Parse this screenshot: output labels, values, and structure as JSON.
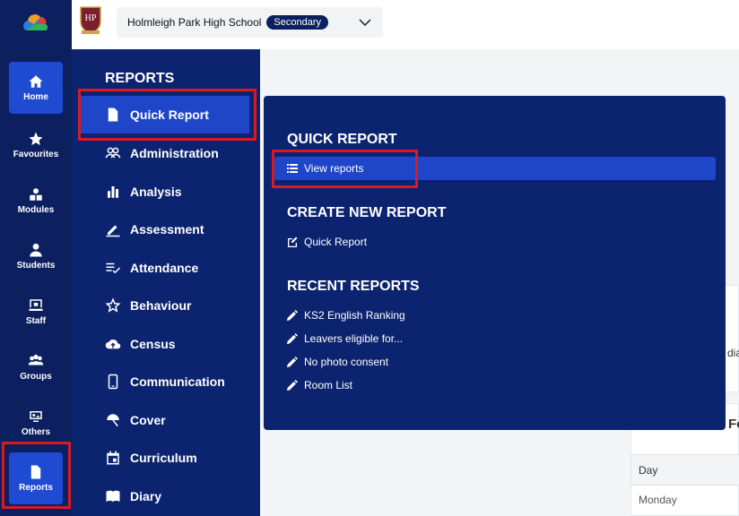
{
  "rail": {
    "items": [
      {
        "label": "Home",
        "icon": "home-icon"
      },
      {
        "label": "Favourites",
        "icon": "star-icon"
      },
      {
        "label": "Modules",
        "icon": "modules-icon"
      },
      {
        "label": "Students",
        "icon": "person-icon"
      },
      {
        "label": "Staff",
        "icon": "staff-icon"
      },
      {
        "label": "Groups",
        "icon": "groups-icon"
      },
      {
        "label": "Others",
        "icon": "others-icon"
      },
      {
        "label": "Reports",
        "icon": "document-icon"
      }
    ]
  },
  "topbar": {
    "school_name": "Holmleigh Park High School",
    "phase_badge": "Secondary"
  },
  "menu": {
    "title": "REPORTS",
    "items": [
      {
        "label": "Quick Report",
        "icon": "document-icon"
      },
      {
        "label": "Administration",
        "icon": "people-icon"
      },
      {
        "label": "Analysis",
        "icon": "bar-chart-icon"
      },
      {
        "label": "Assessment",
        "icon": "pencil-icon"
      },
      {
        "label": "Attendance",
        "icon": "checklist-icon"
      },
      {
        "label": "Behaviour",
        "icon": "star-outline-icon"
      },
      {
        "label": "Census",
        "icon": "cloud-upload-icon"
      },
      {
        "label": "Communication",
        "icon": "phone-icon"
      },
      {
        "label": "Cover",
        "icon": "umbrella-icon"
      },
      {
        "label": "Curriculum",
        "icon": "calendar-icon"
      },
      {
        "label": "Diary",
        "icon": "book-icon"
      }
    ]
  },
  "panel": {
    "quick_report_heading": "QUICK REPORT",
    "view_reports": "View reports",
    "create_heading": "CREATE NEW REPORT",
    "create_quick_report": "Quick Report",
    "recent_heading": "RECENT REPORTS",
    "recent": [
      "KS2 English Ranking",
      "Leavers eligible for...",
      "No photo consent",
      "Room List"
    ]
  },
  "background": {
    "partial_text_1": "dia",
    "partial_text_2": "Fo",
    "table_header": "Day",
    "table_row": "Monday"
  },
  "colors": {
    "rail": "#0c1f5e",
    "menu": "#0c2470",
    "active": "#1f46c8",
    "highlight": "#d81b22"
  }
}
